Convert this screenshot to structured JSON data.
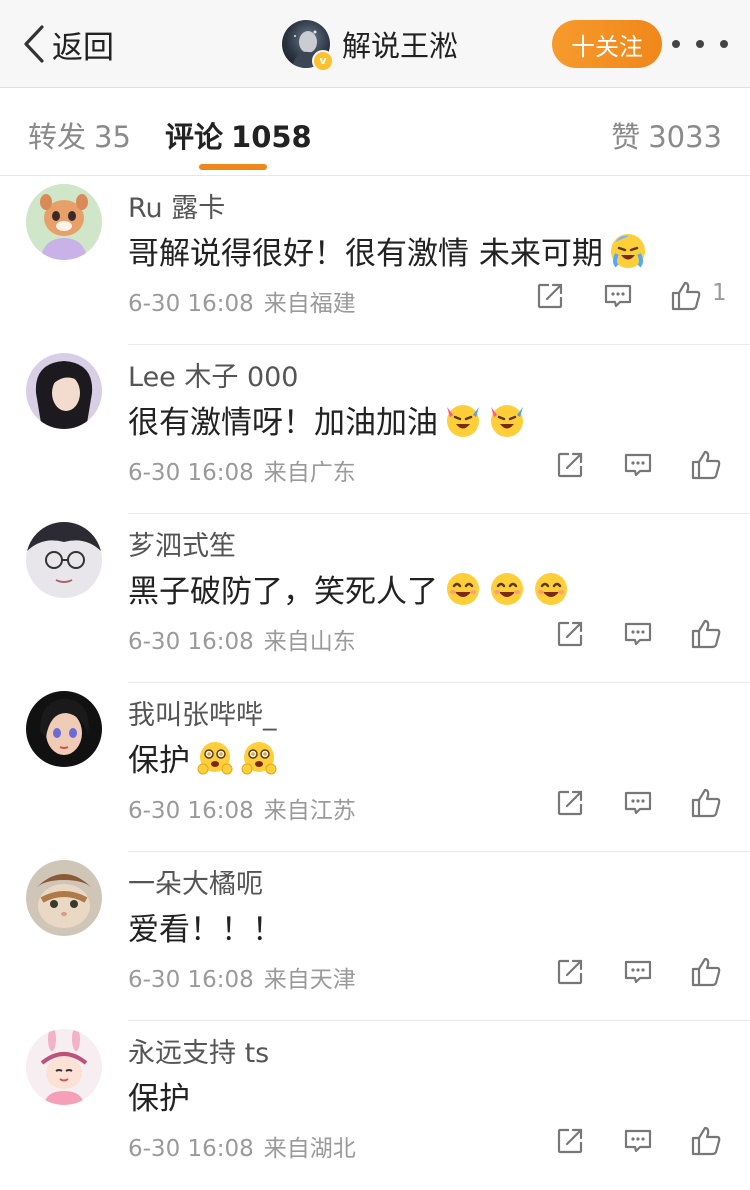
{
  "header": {
    "back_label": "返回",
    "author_name": "解说王淞",
    "verified_mark": "v",
    "follow_label": "十关注"
  },
  "tabs": {
    "repost": {
      "label": "转发",
      "count": "35"
    },
    "comment": {
      "label": "评论",
      "count": "1058"
    },
    "like": {
      "label": "赞",
      "count": "3033"
    }
  },
  "colors": {
    "accent": "#f0871a",
    "verified": "#ffc02e"
  },
  "comments": [
    {
      "user": "Ru 露卡",
      "text": "哥解说得很好！很有激情 未来可期",
      "emojis": [
        "cry-laugh-sweat-emoji"
      ],
      "time": "6-30 16:08",
      "source": "来自福建",
      "likes": "1"
    },
    {
      "user": "Lee 木子 000",
      "text": "很有激情呀！加油加油",
      "emojis": [
        "cheer-emoji",
        "cheer-emoji"
      ],
      "time": "6-30 16:08",
      "source": "来自广东",
      "likes": ""
    },
    {
      "user": "芗泗式笙",
      "text": "黑子破防了，笑死人了",
      "emojis": [
        "laugh-emoji",
        "laugh-emoji",
        "laugh-emoji"
      ],
      "time": "6-30 16:08",
      "source": "来自山东",
      "likes": ""
    },
    {
      "user": "我叫张哔哔_",
      "text": "保护",
      "emojis": [
        "protect-emoji",
        "protect-emoji"
      ],
      "time": "6-30 16:08",
      "source": "来自江苏",
      "likes": ""
    },
    {
      "user": "一朵大橘呃",
      "text": "爱看！！！",
      "emojis": [],
      "time": "6-30 16:08",
      "source": "来自天津",
      "likes": ""
    },
    {
      "user": "永远支持 ts",
      "text": "保护",
      "emojis": [],
      "time": "6-30 16:08",
      "source": "来自湖北",
      "likes": ""
    }
  ]
}
